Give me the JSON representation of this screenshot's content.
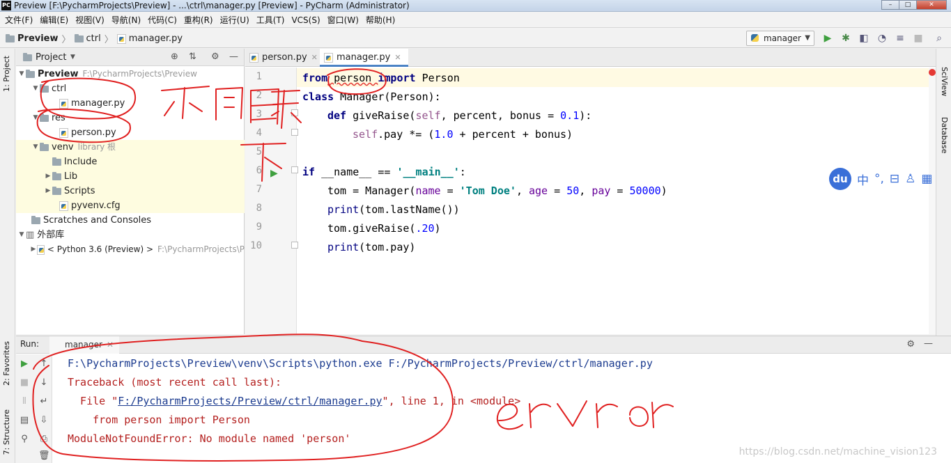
{
  "window": {
    "title": "Preview [F:\\PycharmProjects\\Preview] - ...\\ctrl\\manager.py [Preview] - PyCharm (Administrator)",
    "app_icon": "PC"
  },
  "menu": [
    "文件(F)",
    "编辑(E)",
    "视图(V)",
    "导航(N)",
    "代码(C)",
    "重构(R)",
    "运行(U)",
    "工具(T)",
    "VCS(S)",
    "窗口(W)",
    "帮助(H)"
  ],
  "breadcrumbs": [
    "Preview",
    "ctrl",
    "manager.py"
  ],
  "run_config": "manager",
  "project": {
    "header": "Project",
    "tree": [
      {
        "label": "Preview",
        "extra": "F:\\PycharmProjects\\Preview"
      },
      {
        "label": "ctrl"
      },
      {
        "label": "manager.py"
      },
      {
        "label": "res"
      },
      {
        "label": "person.py"
      },
      {
        "label": "venv",
        "extra": "library 根"
      },
      {
        "label": "Include"
      },
      {
        "label": "Lib"
      },
      {
        "label": "Scripts"
      },
      {
        "label": "pyvenv.cfg"
      },
      {
        "label": "Scratches and Consoles"
      },
      {
        "label": "外部库"
      },
      {
        "label": "< Python 3.6 (Preview) >",
        "extra": "F:\\PycharmProjects\\P"
      }
    ]
  },
  "editor": {
    "tabs": [
      "person.py",
      "manager.py"
    ],
    "line_numbers": [
      "1",
      "2",
      "3",
      "4",
      "5",
      "6",
      "7",
      "8",
      "9",
      "10"
    ]
  },
  "code": {
    "l1": [
      "from",
      " person ",
      "import",
      " Person"
    ],
    "l2": [
      "class",
      " Manager(Person):"
    ],
    "l3": [
      "def",
      " giveRaise(",
      "self",
      ", percent, bonus = ",
      "0.1",
      "):"
    ],
    "l4": [
      "self",
      ".pay *= (",
      "1.0",
      " + percent + bonus)"
    ],
    "l6": [
      "if",
      " __name__ == ",
      "'__main__'",
      ":"
    ],
    "l7": [
      "tom = Manager(",
      "name",
      " = ",
      "'Tom Doe'",
      ", ",
      "age",
      " = ",
      "50",
      ", ",
      "pay",
      " = ",
      "50000",
      ")"
    ],
    "l8": [
      "print",
      "(tom.lastName())"
    ],
    "l9": [
      "tom.giveRaise(",
      ".20",
      ")"
    ],
    "l10": [
      "print",
      "(tom.pay)"
    ]
  },
  "run": {
    "label": "Run:",
    "tab": "manager",
    "console": {
      "cmd": "F:\\PycharmProjects\\Preview\\venv\\Scripts\\python.exe F:/PycharmProjects/Preview/ctrl/manager.py",
      "tb": "Traceback (most recent call last):",
      "file_pre": "  File \"",
      "file_link": "F:/PycharmProjects/Preview/ctrl/manager.py",
      "file_post": "\", line 1, in <module>",
      "src": "    from person import Person",
      "err": "ModuleNotFoundError: No module named 'person'"
    }
  },
  "side_tabs": {
    "left_top": "1: Project",
    "left_fav": "2: Favorites",
    "left_struct": "7: Structure",
    "right_sci": "SciView",
    "right_db": "Database"
  },
  "ime": {
    "logo": "du",
    "mode": "中"
  },
  "annotations": {
    "handwritten_1": "不同目录下",
    "handwritten_2": "error"
  },
  "watermark": "https://blog.csdn.net/machine_vision123"
}
